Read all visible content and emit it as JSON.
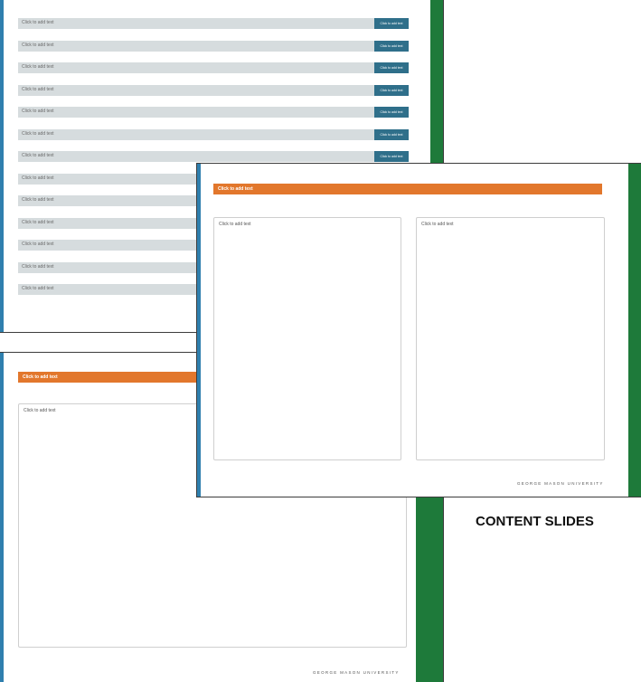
{
  "list_slide": {
    "rows": [
      {
        "text": "Click to add text",
        "button": "Click to add text"
      },
      {
        "text": "Click to add text",
        "button": "Click to add text"
      },
      {
        "text": "Click to add text",
        "button": "Click to add text"
      },
      {
        "text": "Click to add text",
        "button": "Click to add text"
      },
      {
        "text": "Click to add text",
        "button": "Click to add text"
      },
      {
        "text": "Click to add text",
        "button": "Click to add text"
      },
      {
        "text": "Click to add text",
        "button": "Click to add text"
      },
      {
        "text": "Click to add text",
        "button": ""
      },
      {
        "text": "Click to add text",
        "button": ""
      },
      {
        "text": "Click to add text",
        "button": ""
      },
      {
        "text": "Click to add text",
        "button": ""
      },
      {
        "text": "Click to add text",
        "button": ""
      },
      {
        "text": "Click to add text",
        "button": ""
      }
    ]
  },
  "one_column_slide": {
    "title": "Click to add text",
    "body": "Click to add text",
    "footer": "GEORGE MASON UNIVERSITY"
  },
  "two_column_slide": {
    "title": "Click to add text",
    "left_body": "Click to add text",
    "right_body": "Click to add text",
    "footer": "GEORGE MASON UNIVERSITY"
  },
  "caption": "CONTENT SLIDES",
  "colors": {
    "accent_orange": "#e2772c",
    "sidebar_green": "#1e7a3a",
    "sidebar_blue": "#2f7fae",
    "row_gray": "#d6dcde",
    "button_teal": "#2f6f8a"
  }
}
